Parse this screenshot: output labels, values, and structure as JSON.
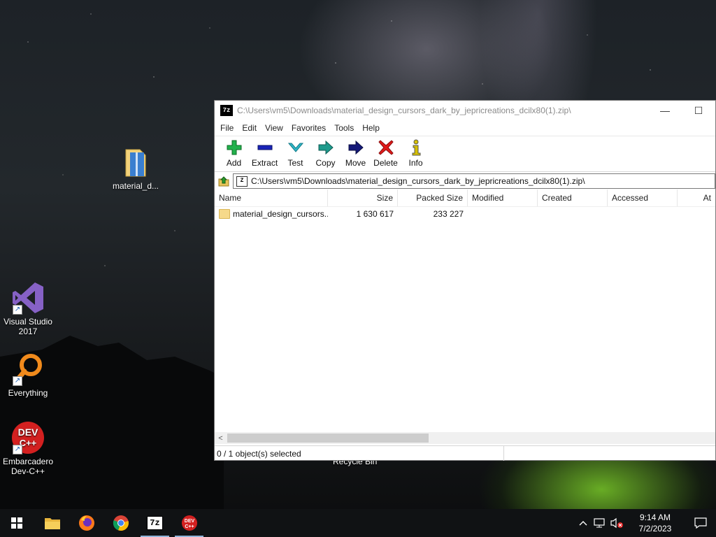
{
  "desktop": {
    "icons": [
      {
        "label": "material_d..."
      },
      {
        "label": "Visual Studio 2017"
      },
      {
        "label": "Everything"
      },
      {
        "label": "Embarcadero Dev-C++",
        "badge_text": "DEV C++"
      }
    ],
    "recycle_label": "Recycle Bin"
  },
  "window": {
    "app_icon_text": "7z",
    "title": "C:\\Users\\vm5\\Downloads\\material_design_cursors_dark_by_jepricreations_dcilx80(1).zip\\",
    "controls": {
      "minimize": "—",
      "maximize": "☐"
    },
    "menu": [
      "File",
      "Edit",
      "View",
      "Favorites",
      "Tools",
      "Help"
    ],
    "toolbar": [
      {
        "label": "Add",
        "icon": "plus-icon",
        "color": "#22b14c"
      },
      {
        "label": "Extract",
        "icon": "minus-icon",
        "color": "#1a24b8"
      },
      {
        "label": "Test",
        "icon": "check-icon",
        "color": "#2fb8c8"
      },
      {
        "label": "Copy",
        "icon": "arrow-right-double-icon",
        "color": "#1e9a8c"
      },
      {
        "label": "Move",
        "icon": "arrow-right-icon",
        "color": "#151a7a"
      },
      {
        "label": "Delete",
        "icon": "x-icon",
        "color": "#e01a1a"
      },
      {
        "label": "Info",
        "icon": "info-icon",
        "color": "#d6c000"
      }
    ],
    "address": "C:\\Users\\vm5\\Downloads\\material_design_cursors_dark_by_jepricreations_dcilx80(1).zip\\",
    "columns": [
      "Name",
      "Size",
      "Packed Size",
      "Modified",
      "Created",
      "Accessed",
      "At"
    ],
    "rows": [
      {
        "name": "material_design_cursors...",
        "size": "1 630 617",
        "packed": "233 227",
        "modified": "",
        "created": "",
        "accessed": ""
      }
    ],
    "scroll_left": "<",
    "status": "0 / 1 object(s) selected"
  },
  "taskbar": {
    "clock_time": "9:14 AM",
    "clock_date": "7/2/2023",
    "seven_zip_text": "7z",
    "devcpp_text": "DEV C++"
  }
}
